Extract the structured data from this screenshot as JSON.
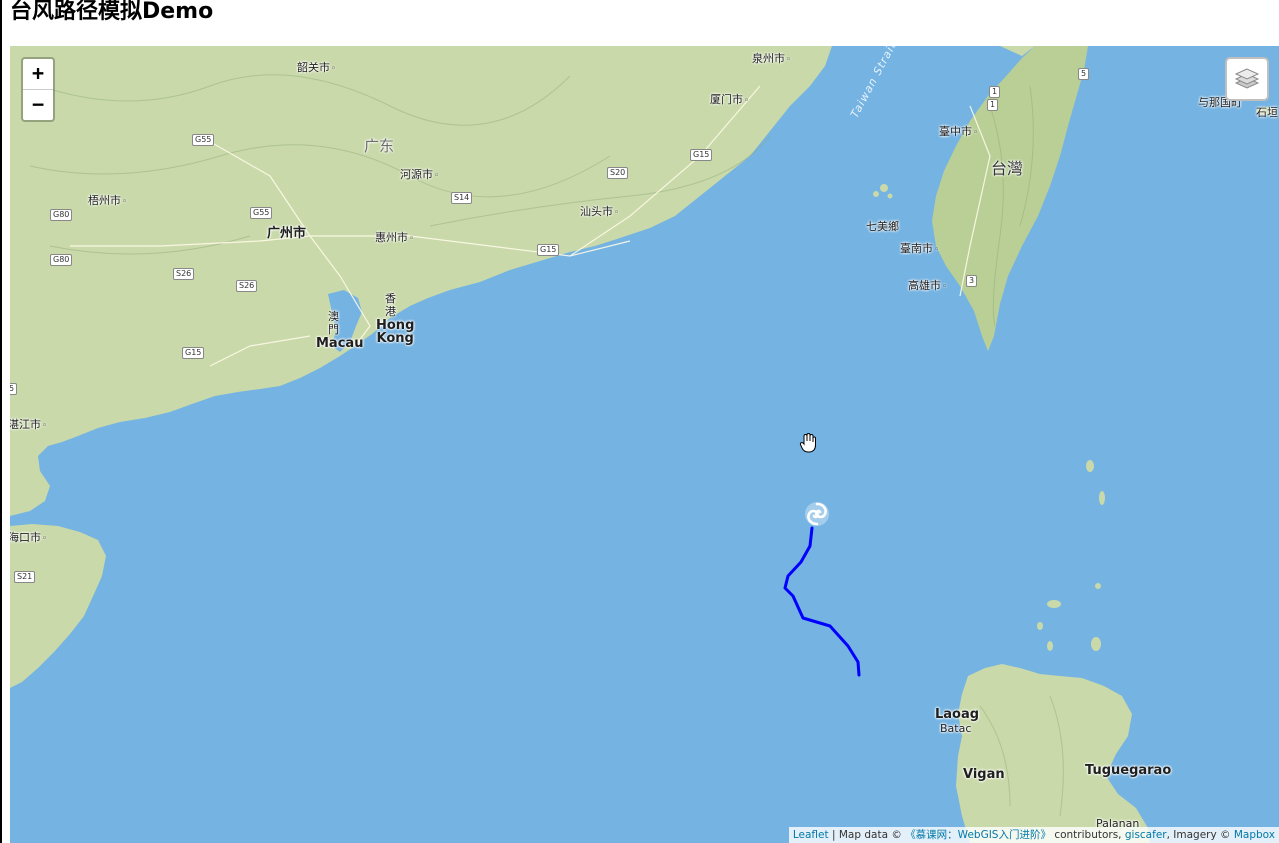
{
  "page": {
    "title": "台风路径模拟Demo"
  },
  "map": {
    "colors": {
      "sea": "#74b3e2",
      "land": "#c7d9a8",
      "track": "#0000ff"
    },
    "places": {
      "shaoguan": "韶关市",
      "quanzhou": "泉州市",
      "xiamen": "厦门市",
      "guangdong": "广东",
      "heyuan": "河源市",
      "wuzhou": "梧州市",
      "shantou": "汕头市",
      "guangzhou": "广州市",
      "huizhou": "惠州市",
      "taichung": "臺中市",
      "taiwan": "台灣",
      "qimei": "七美鄉",
      "tainan": "臺南市",
      "kaohsiung": "高雄市",
      "yonaguni": "与那国町",
      "ishigaki": "石垣",
      "macau_cn": "澳\n門",
      "macau": "Macau",
      "hongkong_cn": "香\n港",
      "hongkong": "Hong\nKong",
      "zhanjiang": "湛江市",
      "haikou": "海口市",
      "laoag": "Laoag",
      "batac": "Batac",
      "vigan": "Vigan",
      "tuguegarao": "Tuguegarao",
      "palanan": "Palanan",
      "taiwan_strait": "Taiwan Strait"
    },
    "shields": {
      "g55a": "G55",
      "g15a": "G15",
      "s20": "S20",
      "g80a": "G80",
      "g55b": "G55",
      "s14": "S14",
      "g80b": "G80",
      "g15b": "G15",
      "s26a": "S26",
      "s26b": "S26",
      "g15c": "G15",
      "s21": "S21",
      "tw5": "5",
      "tw1a": "1",
      "tw1b": "1",
      "tw3": "3",
      "edge5": "5"
    },
    "controls": {
      "zoom_in": "+",
      "zoom_out": "−"
    },
    "track_icon": "typhoon-icon",
    "layers_icon": "layers-icon",
    "cursor_icon": "hand-cursor-icon"
  },
  "attribution": {
    "leaflet": "Leaflet",
    "sep1": " | Map data © ",
    "source": "《慕课网：WebGIS入门进阶》",
    "sep2": " contributors, ",
    "giscafer": "giscafer",
    "sep3": ", Imagery © ",
    "mapbox": "Mapbox"
  }
}
